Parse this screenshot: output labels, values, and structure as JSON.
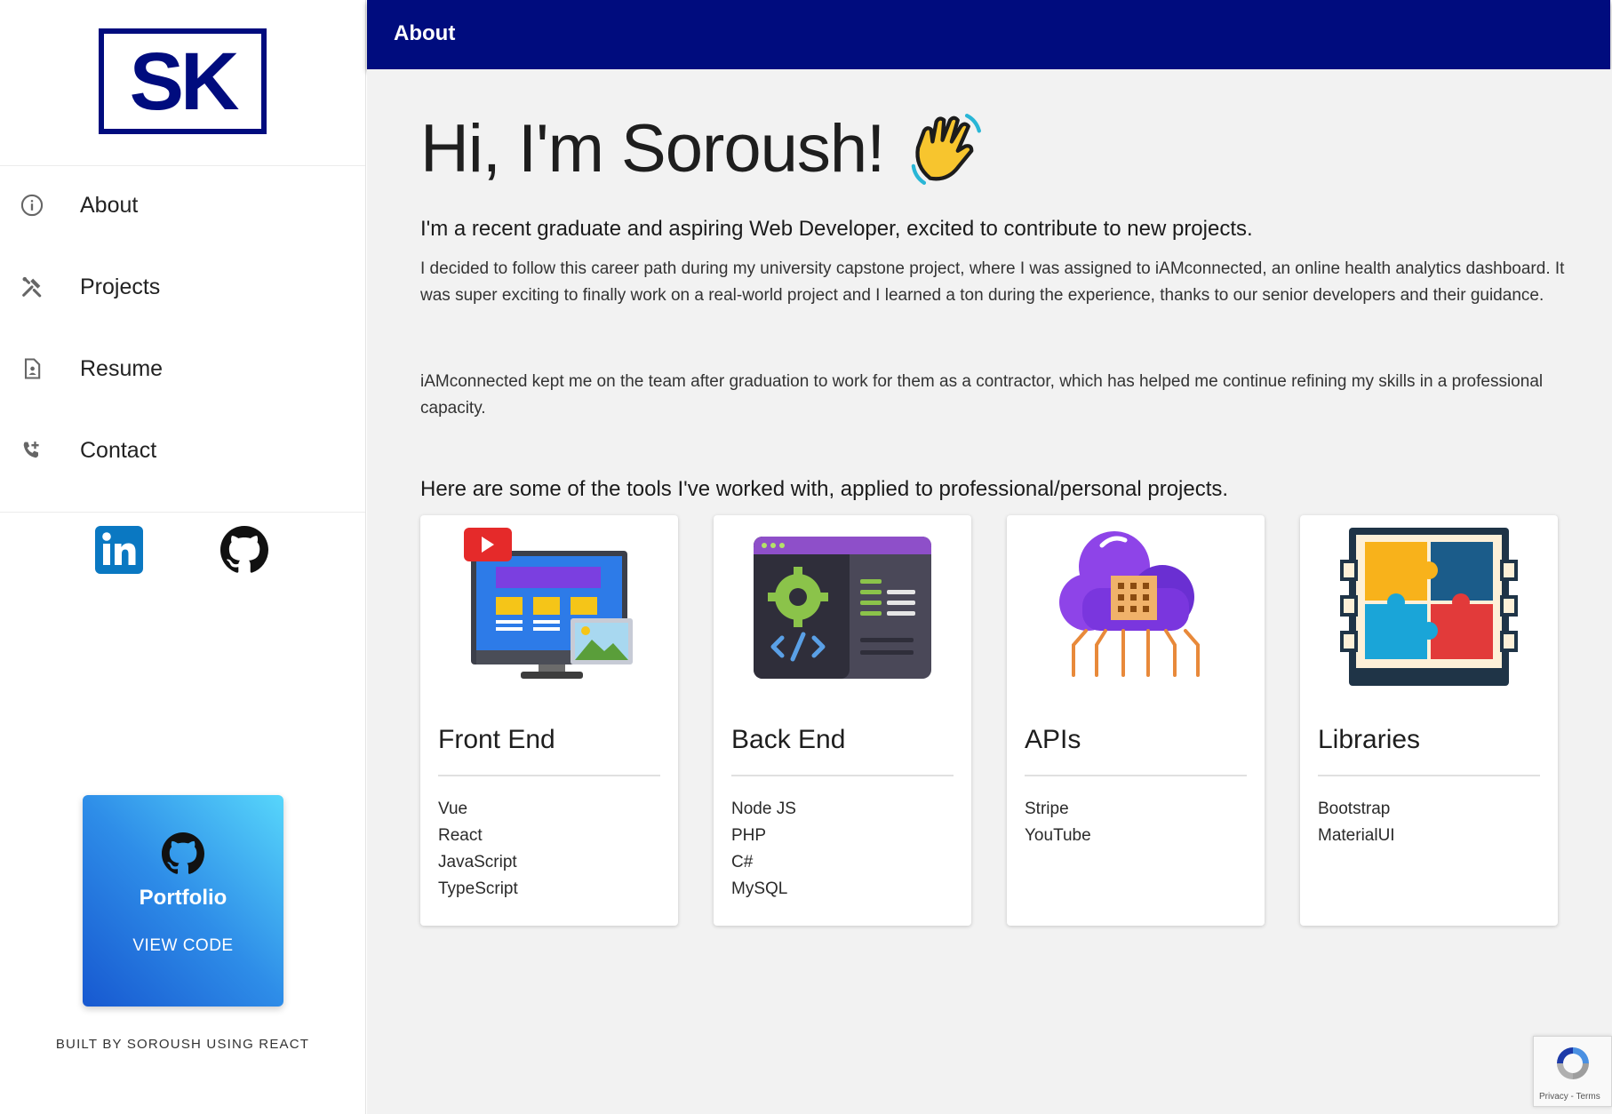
{
  "logo": {
    "text": "SK"
  },
  "sidebar": {
    "items": [
      {
        "label": "About",
        "icon": "info-icon"
      },
      {
        "label": "Projects",
        "icon": "tools-icon"
      },
      {
        "label": "Resume",
        "icon": "resume-icon"
      },
      {
        "label": "Contact",
        "icon": "phone-add-icon"
      }
    ],
    "social": [
      {
        "icon": "linkedin-icon"
      },
      {
        "icon": "github-icon"
      }
    ],
    "portfolio": {
      "title": "Portfolio",
      "link_label": "VIEW CODE",
      "icon": "github-icon"
    },
    "footer": "BUILT BY SOROUSH USING REACT"
  },
  "header": {
    "title": "About"
  },
  "main": {
    "greeting": "Hi, I'm Soroush!",
    "greeting_icon": "waving-hand-icon",
    "intro": "I'm a recent graduate and aspiring Web Developer, excited to contribute to new projects.",
    "paragraphs": [
      "I decided to follow this career path during my university capstone project, where I was assigned to iAMconnected, an online health analytics dashboard. It was super exciting to finally work on a real-world project and I learned a ton during the experience, thanks to our senior developers and their guidance.",
      "iAMconnected kept me on the team after graduation to work for them as a contractor, which has helped me continue refining my skills in a professional capacity."
    ],
    "tools_heading": "Here are some of the tools I've worked with, applied to professional/personal projects.",
    "cards": [
      {
        "title": "Front End",
        "icon": "monitor-illustration",
        "items": [
          "Vue",
          "React",
          "JavaScript",
          "TypeScript"
        ]
      },
      {
        "title": "Back End",
        "icon": "code-window-illustration",
        "items": [
          "Node JS",
          "PHP",
          "C#",
          "MySQL"
        ]
      },
      {
        "title": "APIs",
        "icon": "cloud-chip-illustration",
        "items": [
          "Stripe",
          "YouTube"
        ]
      },
      {
        "title": "Libraries",
        "icon": "puzzle-illustration",
        "items": [
          "Bootstrap",
          "MaterialUI"
        ]
      }
    ]
  },
  "recaptcha": {
    "terms": "Privacy - Terms"
  },
  "colors": {
    "brand_navy": "#000c7e",
    "page_bg": "#f2f2f2",
    "portfolio_gradient_start": "#57d6fb",
    "portfolio_gradient_end": "#1758d0"
  }
}
